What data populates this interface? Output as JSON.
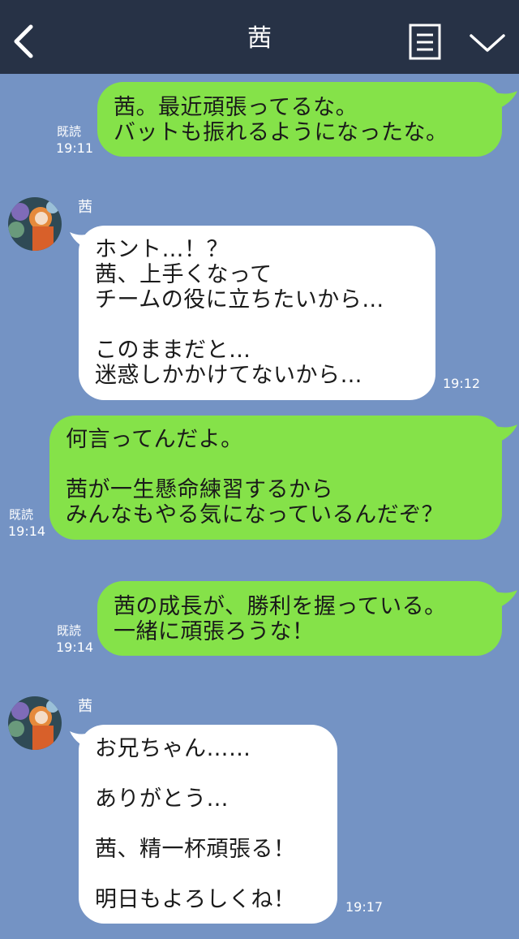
{
  "header": {
    "title": "茜",
    "back_icon": "chevron-left-icon",
    "notes_icon": "notes-icon",
    "menu_icon": "chevron-down-icon",
    "bg_color": "#273246"
  },
  "chat_bg_color": "#7493c4",
  "outgoing_bubble_color": "#85e249",
  "incoming_bubble_color": "#ffffff",
  "messages": [
    {
      "direction": "out",
      "text": "茜。最近頑張ってるな。\nバットも振れるようになったな。",
      "read": "既読",
      "time": "19:11"
    },
    {
      "direction": "in",
      "sender": "茜",
      "text": "ホント…！？\n茜、上手くなって\nチームの役に立ちたいから…\n\nこのままだと…\n迷惑しかかけてないから…",
      "time": "19:12"
    },
    {
      "direction": "out",
      "text": "何言ってんだよ。\n\n茜が一生懸命練習するから\nみんなもやる気になっているんだぞ？",
      "read": "既読",
      "time": "19:14"
    },
    {
      "direction": "out",
      "text": "茜の成長が、勝利を握っている。\n一緒に頑張ろうな！",
      "read": "既読",
      "time": "19:14"
    },
    {
      "direction": "in",
      "sender": "茜",
      "text": "お兄ちゃん……\n\nありがとう…\n\n茜、精一杯頑張る！\n\n明日もよろしくね！",
      "time": "19:17"
    }
  ]
}
